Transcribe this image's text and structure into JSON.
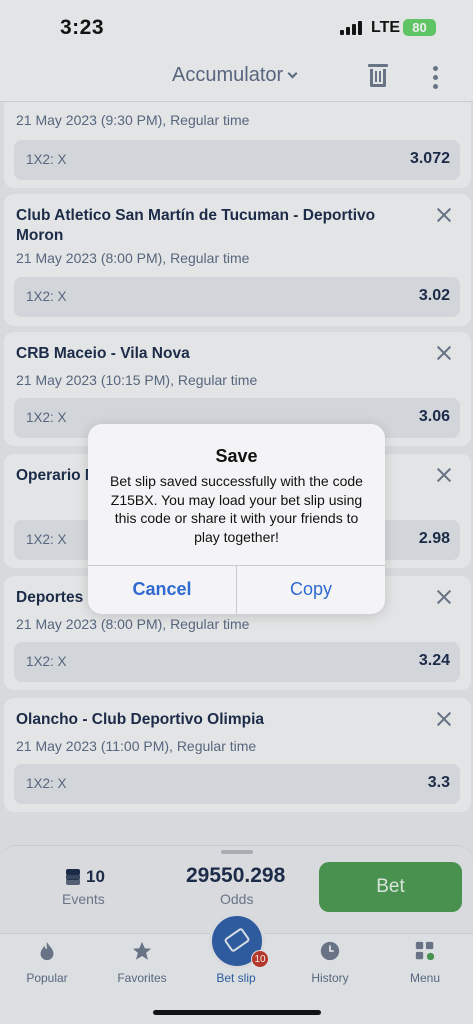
{
  "status_bar": {
    "time": "3:23",
    "network": "LTE",
    "battery": "80"
  },
  "header": {
    "title": "Accumulator",
    "trash_icon": "trash-icon",
    "more_icon": "more-vertical-icon"
  },
  "events": [
    {
      "title": "",
      "meta": "21 May 2023 (9:30 PM), Regular time",
      "market": "1X2: X",
      "odds": "3.072"
    },
    {
      "title": "Club Atletico San Martín de Tucuman - Deportivo Moron",
      "meta": "21 May 2023 (8:00 PM), Regular time",
      "market": "1X2: X",
      "odds": "3.02"
    },
    {
      "title": "CRB Maceio - Vila Nova",
      "meta": "21 May 2023 (10:15 PM), Regular time",
      "market": "1X2: X",
      "odds": "3.06"
    },
    {
      "title": "Operario M",
      "meta": "",
      "market": "1X2: X",
      "odds": "2.98"
    },
    {
      "title": "Deportes",
      "meta": "21 May 2023 (8:00 PM), Regular time",
      "market": "1X2: X",
      "odds": "3.24"
    },
    {
      "title": "Olancho - Club Deportivo Olimpia",
      "meta": "21 May 2023 (11:00 PM), Regular time",
      "market": "1X2: X",
      "odds": "3.3"
    }
  ],
  "summary": {
    "events_count": "10",
    "events_label": "Events",
    "odds_value": "29550.298",
    "odds_label": "Odds",
    "bet_label": "Bet"
  },
  "tabs": [
    {
      "label": "Popular",
      "icon": "flame-icon"
    },
    {
      "label": "Favorites",
      "icon": "star-icon"
    },
    {
      "label": "Bet slip",
      "icon": "ticket-icon",
      "badge": "10"
    },
    {
      "label": "History",
      "icon": "clock-icon"
    },
    {
      "label": "Menu",
      "icon": "grid-icon"
    }
  ],
  "alert": {
    "title": "Save",
    "message": "Bet slip saved successfully with the code Z15BX. You may load your bet slip using this code or share it with your friends to play together!",
    "cancel_label": "Cancel",
    "copy_label": "Copy"
  },
  "colors": {
    "accent": "#2f6ad0",
    "bet_button": "#4c9a52",
    "badge": "#c0392b"
  }
}
